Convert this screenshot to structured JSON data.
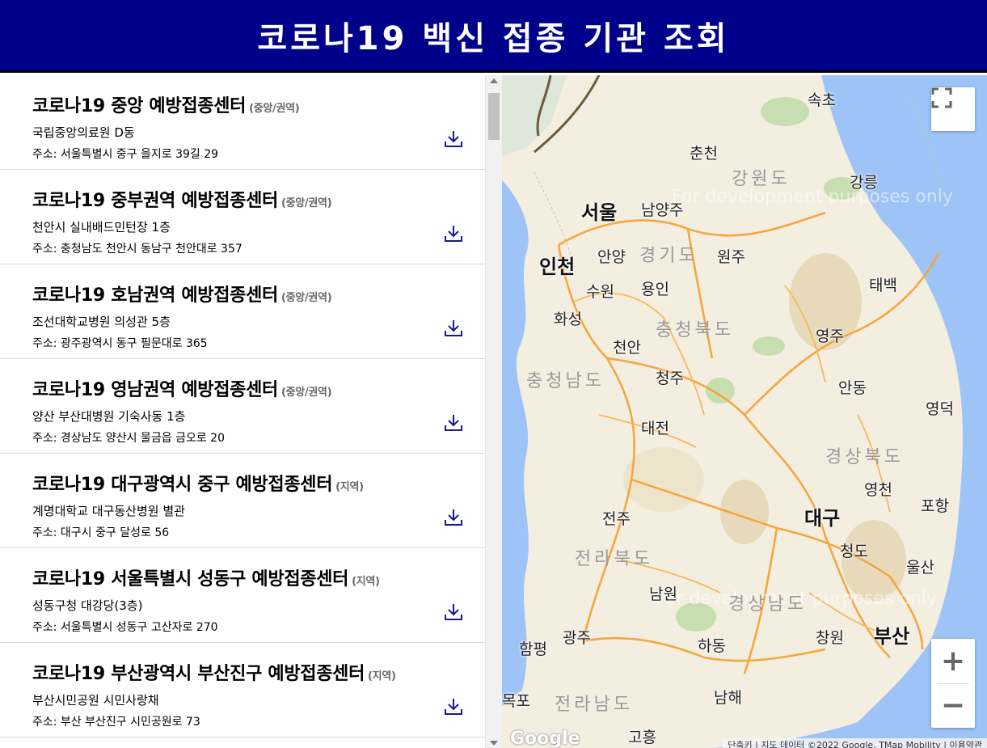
{
  "header": {
    "title": "코로나19 백신 접종 기관 조회"
  },
  "colors": {
    "header_bg": "#00008b",
    "map_water": "#9ec4f7",
    "map_land": "#f3eee0",
    "road": "#f7a43a"
  },
  "centers": [
    {
      "name": "코로나19 중앙 예방접종센터",
      "tag": "(중앙/권역)",
      "facility": "국립중앙의료원 D동",
      "address": "주소: 서울특별시 중구 을지로 39길 29",
      "icon": "download-icon"
    },
    {
      "name": "코로나19 중부권역 예방접종센터",
      "tag": "(중앙/권역)",
      "facility": "천안시 실내배드민턴장 1층",
      "address": "주소: 충청남도 천안시 동남구 천안대로 357",
      "icon": "download-icon"
    },
    {
      "name": "코로나19 호남권역 예방접종센터",
      "tag": "(중앙/권역)",
      "facility": "조선대학교병원 의성관 5층",
      "address": "주소: 광주광역시 동구 필문대로 365",
      "icon": "download-icon"
    },
    {
      "name": "코로나19 영남권역 예방접종센터",
      "tag": "(중앙/권역)",
      "facility": "양산 부산대병원 기숙사동 1층",
      "address": "주소: 경상남도 양산시 물금읍 금오로 20",
      "icon": "download-icon"
    },
    {
      "name": "코로나19 대구광역시 중구 예방접종센터",
      "tag": "(지역)",
      "facility": "계명대학교 대구동산병원 별관",
      "address": "주소: 대구시 중구 달성로 56",
      "icon": "download-icon"
    },
    {
      "name": "코로나19 서울특별시 성동구 예방접종센터",
      "tag": "(지역)",
      "facility": "성동구청 대강당(3층)",
      "address": "주소: 서울특별시 성동구 고산자로 270",
      "icon": "download-icon"
    },
    {
      "name": "코로나19 부산광역시 부산진구 예방접종센터",
      "tag": "(지역)",
      "facility": "부산시민공원 시민사랑채",
      "address": "주소: 부산 부산진구 시민공원로 73",
      "icon": "download-icon"
    }
  ],
  "map": {
    "cities": {
      "sokcho": "속초",
      "chuncheon": "춘천",
      "gangneung": "강릉",
      "seoul": "서울",
      "namyangju": "남양주",
      "incheon": "인천",
      "anyang": "안양",
      "wonju": "원주",
      "suwon": "수원",
      "yongin": "용인",
      "taebaek": "태백",
      "hwaseong": "화성",
      "yeongju": "영주",
      "cheonan": "천안",
      "cheongju": "청주",
      "andong": "안동",
      "yeongdeok": "영덕",
      "daejeon": "대전",
      "yeongcheon": "영천",
      "pohang": "포항",
      "jeonju": "전주",
      "daegu": "대구",
      "cheongdo": "청도",
      "ulsan": "울산",
      "namwon": "남원",
      "gwangju": "광주",
      "hampyeong": "함평",
      "changwon": "창원",
      "busan": "부산",
      "hadong": "하동",
      "mokpo": "목포",
      "namhae": "남해",
      "goheung": "고흥"
    },
    "provinces": {
      "gangwon": "강원도",
      "gyeonggi": "경기도",
      "chungbuk": "충청북도",
      "chungnam": "충청남도",
      "gyeongbuk": "경상북도",
      "jeonbuk": "전라북도",
      "gyeongnam": "경상남도",
      "jeonnam": "전라남도"
    },
    "watermark": "For development purposes only",
    "logo": "Google",
    "attribution": "단축키 | 지도 데이터 ©2022 Google, TMap Mobility | 이용약관",
    "zoom_in": "+",
    "zoom_out": "−",
    "fullscreen_icon": "fullscreen-icon"
  }
}
